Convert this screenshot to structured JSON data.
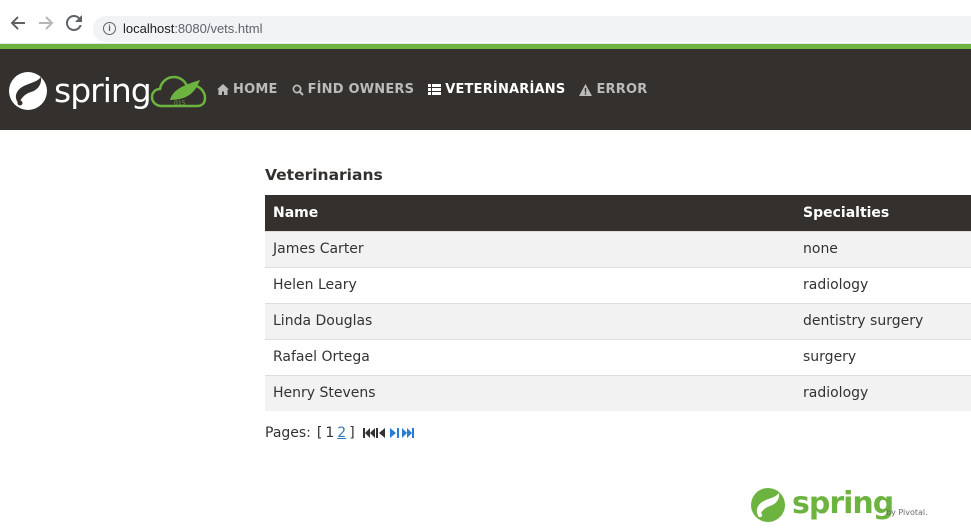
{
  "browser": {
    "url_host": "localhost",
    "url_rest": ":8080/vets.html"
  },
  "brand": {
    "name": "spring",
    "badge": "015"
  },
  "nav": {
    "items": [
      {
        "label": "HOME",
        "icon": "home-icon"
      },
      {
        "label": "FİND OWNERS",
        "icon": "search-icon"
      },
      {
        "label": "VETERİNARİANS",
        "icon": "list-icon"
      },
      {
        "label": "ERROR",
        "icon": "warning-icon"
      }
    ]
  },
  "page": {
    "title": "Veterinarians"
  },
  "table": {
    "headers": [
      "Name",
      "Specialties"
    ],
    "rows": [
      {
        "name": "James Carter",
        "specialties": "none"
      },
      {
        "name": "Helen Leary",
        "specialties": "radiology"
      },
      {
        "name": "Linda Douglas",
        "specialties": "dentistry surgery"
      },
      {
        "name": "Rafael Ortega",
        "specialties": "surgery"
      },
      {
        "name": "Henry Stevens",
        "specialties": "radiology"
      }
    ]
  },
  "pager": {
    "label": "Pages:",
    "open_bracket": "[",
    "close_bracket": "]",
    "current": "1",
    "other": "2",
    "icons": [
      "first-page-icon",
      "previous-page-icon",
      "next-page-icon",
      "last-page-icon"
    ]
  },
  "footer": {
    "text": "spring",
    "by": "by Pivotal."
  },
  "colors": {
    "navbar": "#34302d",
    "accent": "#6db33f",
    "link": "#337ab7"
  }
}
